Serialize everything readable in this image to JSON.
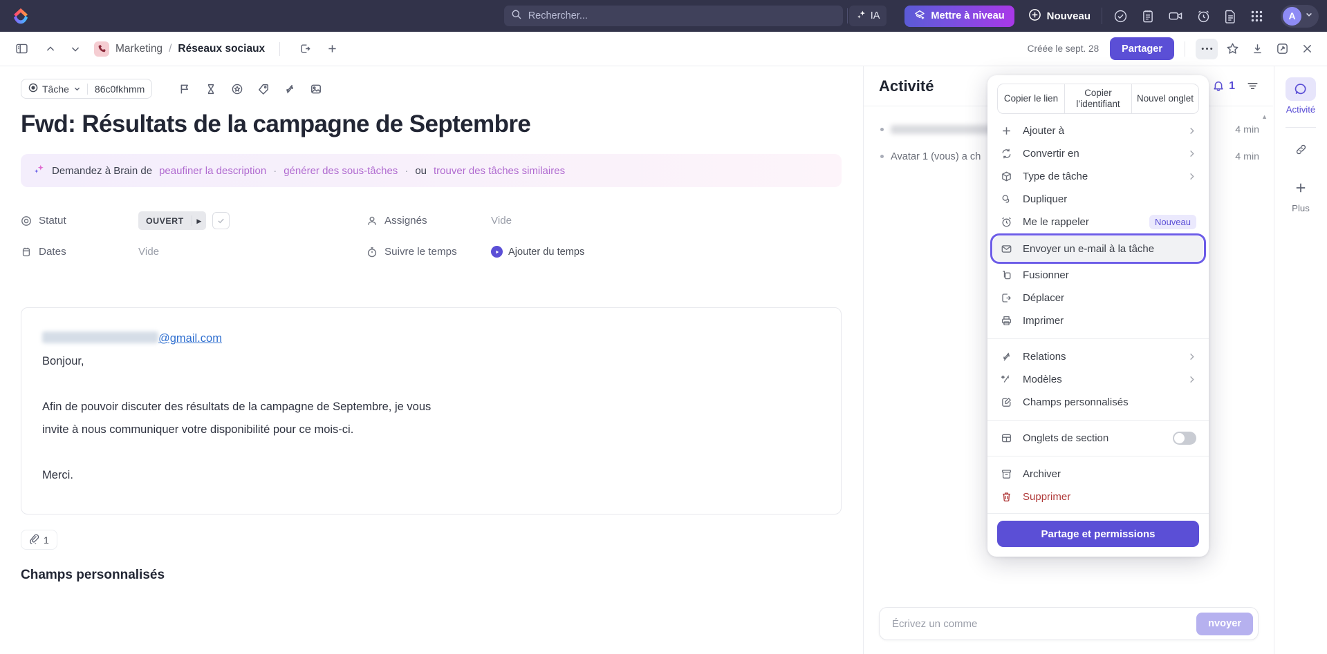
{
  "topbar": {
    "logo_name": "clickup-logo",
    "search": {
      "placeholder": "Rechercher...",
      "icon": "search-icon"
    },
    "ai_chip": {
      "label": "IA",
      "icon": "sparkle-icon"
    },
    "upgrade": {
      "label": "Mettre à niveau",
      "icon": "upgrade-rocket-icon"
    },
    "new": {
      "label": "Nouveau",
      "icon": "plus-circle-icon"
    },
    "icons": [
      "check-circle-icon",
      "clipboard-icon",
      "video-camera-icon",
      "alarm-clock-icon",
      "document-icon",
      "app-grid-icon"
    ],
    "avatar": {
      "initial": "A",
      "chevron": "chevron-down-icon"
    }
  },
  "taskbar": {
    "sidebar_toggle_icon": "panel-toggle-icon",
    "prev_icon": "chevron-up-icon",
    "next_icon": "chevron-down-icon",
    "breadcrumb": {
      "space_icon": "phone-icon",
      "space": "Marketing",
      "separator": "/",
      "list": "Réseaux sociaux"
    },
    "open_icon": "open-external-icon",
    "add_icon": "plus-icon",
    "created_text": "Créée le sept. 28",
    "share_label": "Partager",
    "more_icon": "ellipsis-icon",
    "star_icon": "star-icon",
    "collapse_icon": "collapse-down-icon",
    "expand_icon": "expand-icon",
    "close_icon": "close-icon"
  },
  "task": {
    "type_label": "Tâche",
    "type_chevron": "chevron-down-icon",
    "task_id": "86c0fkhmm",
    "quick_icons": [
      "flag-icon",
      "hourglass-icon",
      "target-star-icon",
      "tag-icon",
      "relationship-icon",
      "cover-image-icon"
    ],
    "title": "Fwd: Résultats de la campagne de Septembre",
    "brain": {
      "icon": "sparkle-icon",
      "prefix": "Demandez à Brain de",
      "link1": "peaufiner la description",
      "dot1": "·",
      "link2": "générer des sous-tâches",
      "dot2": "·",
      "ou": "ou",
      "link3": "trouver des tâches similaires"
    },
    "fields": {
      "status_label": "Statut",
      "status_icon": "status-circle-icon",
      "status_value": "OUVERT",
      "status_caret": "▸",
      "assignees_label": "Assignés",
      "assignees_icon": "person-icon",
      "assignees_value": "Vide",
      "dates_label": "Dates",
      "dates_icon": "calendar-icon",
      "dates_value": "Vide",
      "time_label": "Suivre le temps",
      "time_icon": "stopwatch-icon",
      "time_action": "Ajouter du temps"
    },
    "description": {
      "email_domain": "@gmail.com",
      "line_greeting": "Bonjour,",
      "line_body_1": "Afin de pouvoir discuter des résultats de la campagne de Septembre, je vous",
      "line_body_2": "invite à nous communiquer votre disponibilité pour ce mois-ci.",
      "line_thanks": "Merci."
    },
    "attachment_count": "1",
    "attachment_icon": "paperclip-icon",
    "custom_fields_heading": "Champs personnalisés"
  },
  "activity": {
    "title": "Activité",
    "bell_icon": "notification-bell-icon",
    "bell_count": "1",
    "filter_icon": "filter-icon",
    "items": [
      {
        "text": "",
        "redacted": true,
        "time": "4 min"
      },
      {
        "text": "Avatar 1 (vous) a ch",
        "redacted": false,
        "time": "4 min"
      }
    ],
    "comment_placeholder": "Écrivez un comme",
    "send_label": "nvoyer"
  },
  "rail": {
    "activity_label": "Activité",
    "activity_icon": "activity-bubble-icon",
    "link_icon": "paperclip-link-icon",
    "plus_icon": "plus-icon",
    "plus_label": "Plus"
  },
  "context_menu": {
    "segments": [
      {
        "label": "Copier le lien"
      },
      {
        "label": "Copier l’identifiant"
      },
      {
        "label": "Nouvel onglet"
      }
    ],
    "groups": [
      {
        "items": [
          {
            "label": "Ajouter à",
            "icon": "plus-icon",
            "chevron": true
          },
          {
            "label": "Convertir en",
            "icon": "convert-icon",
            "chevron": true
          },
          {
            "label": "Type de tâche",
            "icon": "cube-icon",
            "chevron": true
          },
          {
            "label": "Dupliquer",
            "icon": "duplicate-icon",
            "chevron": false
          },
          {
            "label": "Me le rappeler",
            "icon": "alarm-clock-icon",
            "chevron": false,
            "badge": "Nouveau"
          },
          {
            "label": "Envoyer un e-mail à la tâche",
            "icon": "envelope-icon",
            "chevron": false,
            "selected": true
          },
          {
            "label": "Fusionner",
            "icon": "merge-icon",
            "chevron": false
          },
          {
            "label": "Déplacer",
            "icon": "move-icon",
            "chevron": false
          },
          {
            "label": "Imprimer",
            "icon": "printer-icon",
            "chevron": false
          }
        ]
      },
      {
        "items": [
          {
            "label": "Relations",
            "icon": "relationship-icon",
            "chevron": true
          },
          {
            "label": "Modèles",
            "icon": "magic-wand-icon",
            "chevron": true
          },
          {
            "label": "Champs personnalisés",
            "icon": "edit-square-icon",
            "chevron": false
          }
        ]
      },
      {
        "items": [
          {
            "label": "Onglets de section",
            "icon": "layout-icon",
            "toggle": true,
            "toggle_on": false
          }
        ]
      },
      {
        "items": [
          {
            "label": "Archiver",
            "icon": "archive-icon",
            "chevron": false
          },
          {
            "label": "Supprimer",
            "icon": "trash-icon",
            "chevron": false,
            "danger": true
          }
        ]
      }
    ],
    "footer_button": "Partage et permissions"
  },
  "colors": {
    "topbar_bg": "#32334a",
    "accent": "#5b4fd6",
    "accent_light": "#ebe9fd",
    "danger": "#b03a3a",
    "selection_outline": "#6c5ce7"
  }
}
